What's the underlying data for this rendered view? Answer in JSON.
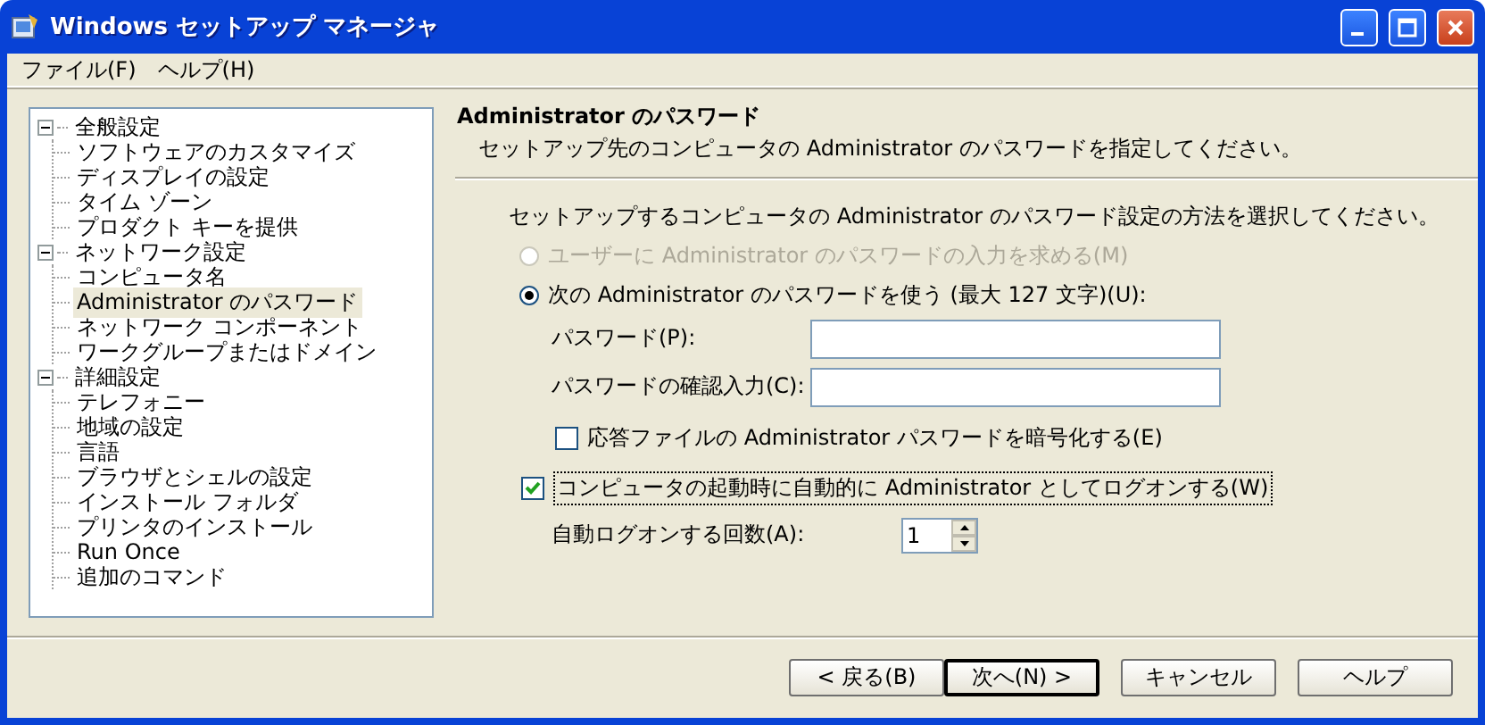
{
  "window": {
    "title": "Windows セットアップ マネージャ"
  },
  "menu": [
    "ファイル(F)",
    "ヘルプ(H)"
  ],
  "tree": [
    {
      "label": "全般設定",
      "expanded": true,
      "children": [
        {
          "label": "ソフトウェアのカスタマイズ",
          "selected": false
        },
        {
          "label": "ディスプレイの設定",
          "selected": false
        },
        {
          "label": "タイム ゾーン",
          "selected": false
        },
        {
          "label": "プロダクト キーを提供",
          "selected": false
        }
      ]
    },
    {
      "label": "ネットワーク設定",
      "expanded": true,
      "children": [
        {
          "label": "コンピュータ名",
          "selected": false
        },
        {
          "label": "Administrator のパスワード",
          "selected": true
        },
        {
          "label": "ネットワーク コンポーネント",
          "selected": false
        },
        {
          "label": "ワークグループまたはドメイン",
          "selected": false
        }
      ]
    },
    {
      "label": "詳細設定",
      "expanded": true,
      "children": [
        {
          "label": "テレフォニー",
          "selected": false
        },
        {
          "label": "地域の設定",
          "selected": false
        },
        {
          "label": "言語",
          "selected": false
        },
        {
          "label": "ブラウザとシェルの設定",
          "selected": false
        },
        {
          "label": "インストール フォルダ",
          "selected": false
        },
        {
          "label": "プリンタのインストール",
          "selected": false
        },
        {
          "label": "Run Once",
          "selected": false
        },
        {
          "label": "追加のコマンド",
          "selected": false
        }
      ]
    }
  ],
  "header": {
    "title": "Administrator のパスワード",
    "description": "セットアップ先のコンピュータの Administrator のパスワードを指定してください。"
  },
  "prompt": "セットアップするコンピュータの Administrator のパスワード設定の方法を選択してください。",
  "radios": [
    {
      "label": "ユーザーに Administrator のパスワードの入力を求める(M)",
      "selected": false,
      "disabled": true
    },
    {
      "label": "次の Administrator のパスワードを使う (最大 127 文字)(U):",
      "selected": true,
      "disabled": false
    }
  ],
  "fields": [
    {
      "label": "パスワード(P):"
    },
    {
      "label": "パスワードの確認入力(C):"
    }
  ],
  "encrypt": {
    "label": "応答ファイルの Administrator パスワードを暗号化する(E)",
    "checked": false
  },
  "autologon": {
    "label": "コンピュータの起動時に自動的に Administrator としてログオンする(W)",
    "checked": true
  },
  "logon_count": {
    "label": "自動ログオンする回数(A):",
    "value": "1"
  },
  "buttons": [
    {
      "label": "< 戻る(B)",
      "default": false
    },
    {
      "label": "次へ(N) >",
      "default": true
    },
    {
      "label": "キャンセル",
      "default": false
    },
    {
      "label": "ヘルプ",
      "default": false
    }
  ]
}
